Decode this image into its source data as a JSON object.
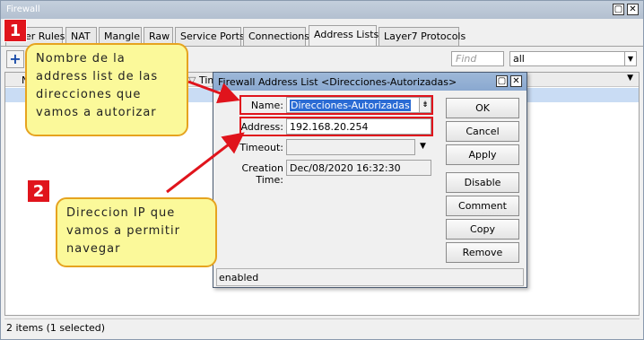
{
  "window": {
    "title": "Firewall"
  },
  "tabs": [
    "Filter Rules",
    "NAT",
    "Mangle",
    "Raw",
    "Service Ports",
    "Connections",
    "Address Lists",
    "Layer7 Protocols"
  ],
  "toolbar": {
    "find_placeholder": "Find",
    "filter_value": "all"
  },
  "table": {
    "col_name_trunc": "N",
    "col_timeout_trunc": "Tim"
  },
  "status": "2 items (1 selected)",
  "dialog": {
    "title": "Firewall Address List <Direcciones-Autorizadas>",
    "name_label": "Name:",
    "name_value": "Direcciones-Autorizadas",
    "address_label": "Address:",
    "address_value": "192.168.20.254",
    "timeout_label": "Timeout:",
    "timeout_value": "",
    "creation_label": "Creation Time:",
    "creation_value": "Dec/08/2020 16:32:30",
    "buttons": {
      "ok": "OK",
      "cancel": "Cancel",
      "apply": "Apply",
      "disable": "Disable",
      "comment": "Comment",
      "copy": "Copy",
      "remove": "Remove"
    },
    "status": "enabled"
  },
  "annotations": {
    "badge1": "1",
    "badge2": "2",
    "note1": "Nombre de la address list de las direcciones que vamos a autorizar",
    "note2": "Direccion IP que vamos a permitir navegar"
  },
  "colors": {
    "annotation_red": "#e0141c",
    "note_fill": "#fbf99a",
    "note_border": "#e6a31f",
    "selection": "#2a6bd4"
  }
}
